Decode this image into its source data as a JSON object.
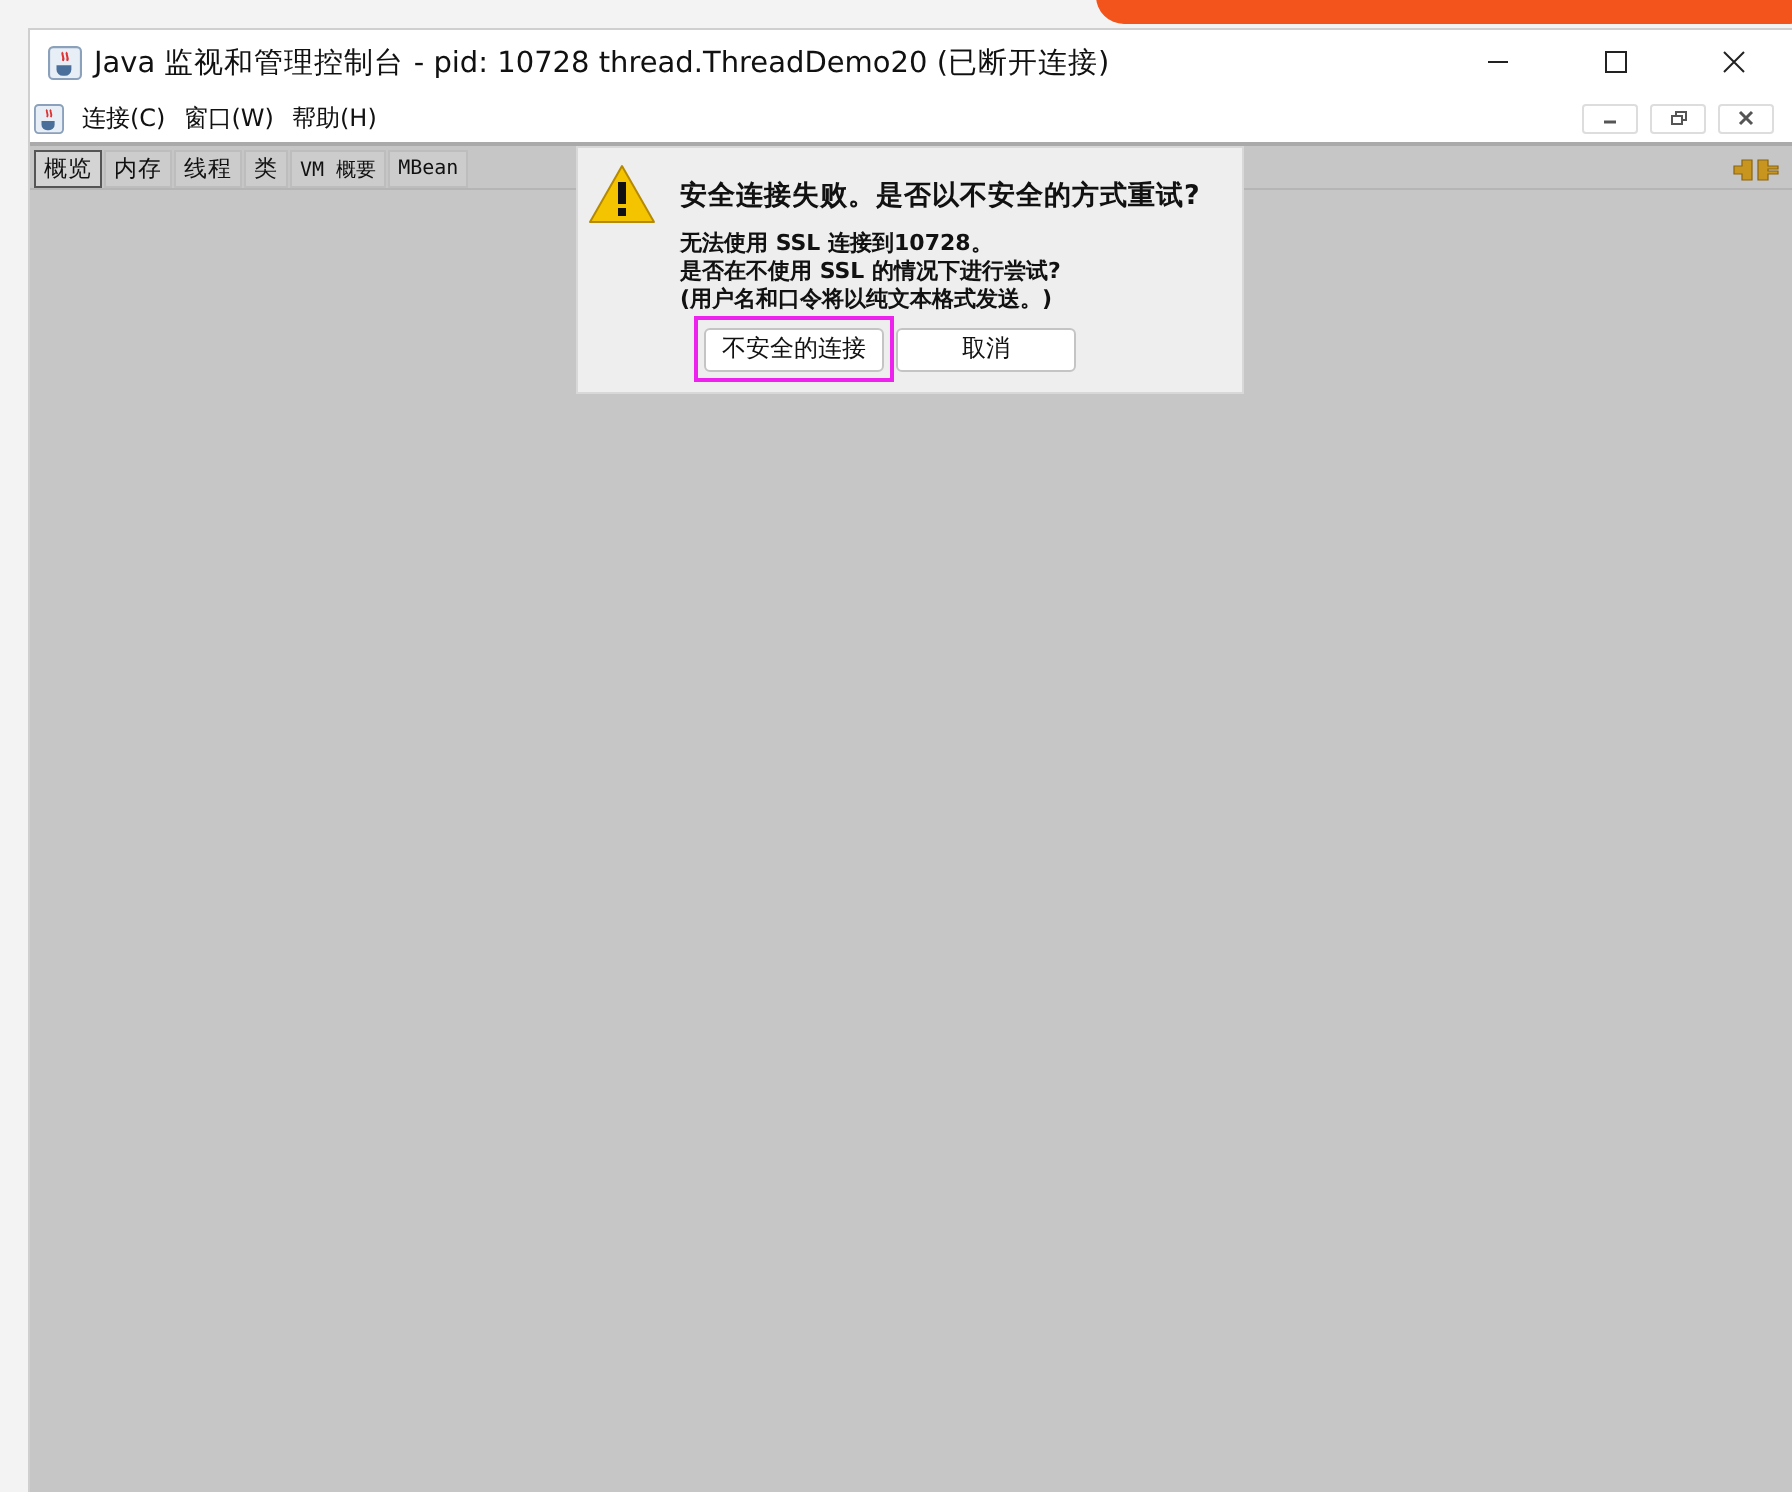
{
  "window": {
    "title": "Java 监视和管理控制台 - pid: 10728 thread.ThreadDemo20 (已断开连接)"
  },
  "menu": [
    {
      "label": "连接(C)"
    },
    {
      "label": "窗口(W)"
    },
    {
      "label": "帮助(H)"
    }
  ],
  "tabs": [
    {
      "label": "概览",
      "selected": true
    },
    {
      "label": "内存",
      "selected": false
    },
    {
      "label": "线程",
      "selected": false
    },
    {
      "label": "类",
      "selected": false
    },
    {
      "label": "VM 概要",
      "selected": false
    },
    {
      "label": "MBean",
      "selected": false
    }
  ],
  "dialog": {
    "heading": "安全连接失败。是否以不安全的方式重试?",
    "lines": [
      "无法使用 SSL 连接到10728。",
      "是否在不使用 SSL 的情况下进行尝试?",
      "(用户名和口令将以纯文本格式发送。)"
    ],
    "buttons": [
      {
        "label": "不安全的连接",
        "highlighted": true
      },
      {
        "label": "取消",
        "highlighted": false
      }
    ]
  }
}
